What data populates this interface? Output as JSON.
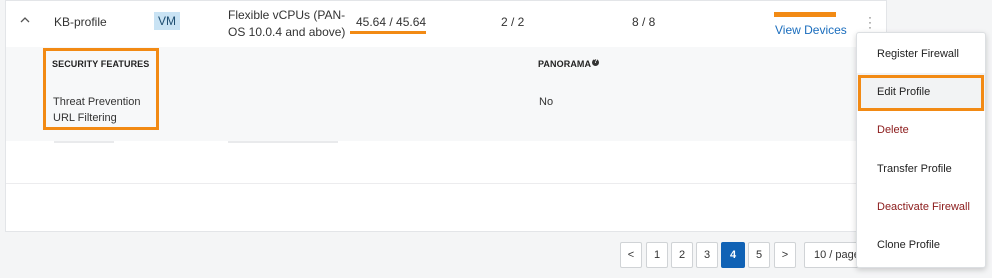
{
  "row": {
    "name": "KB-profile",
    "badge": "VM",
    "model_line1": "Flexible vCPUs (PAN-",
    "model_line2": "OS 10.0.4 and above)",
    "credits": "45.64 / 45.64",
    "col_a": "2 / 2",
    "col_b": "8 / 8",
    "view_devices": "View Devices"
  },
  "details": {
    "security_header": "SECURITY FEATURES",
    "panorama_header": "PANORAMA",
    "help_glyph": "?",
    "features": [
      "Threat Prevention",
      "URL Filtering"
    ],
    "panorama_value": "No"
  },
  "menu": {
    "items": [
      {
        "label": "Register Firewall",
        "style": "normal"
      },
      {
        "label": "Edit Profile",
        "style": "highlighted"
      },
      {
        "label": "Delete",
        "style": "danger"
      },
      {
        "label": "Transfer Profile",
        "style": "normal"
      },
      {
        "label": "Deactivate Firewall",
        "style": "danger"
      },
      {
        "label": "Clone Profile",
        "style": "normal"
      }
    ]
  },
  "pagination": {
    "prev": "<",
    "pages": [
      "1",
      "2",
      "3",
      "4",
      "5"
    ],
    "current": "4",
    "next": ">",
    "page_size": "10 / page"
  },
  "colors": {
    "highlight": "#f28a14",
    "active_page": "#1062b5",
    "link": "#1a6dbd",
    "danger": "#8b1a1a"
  }
}
